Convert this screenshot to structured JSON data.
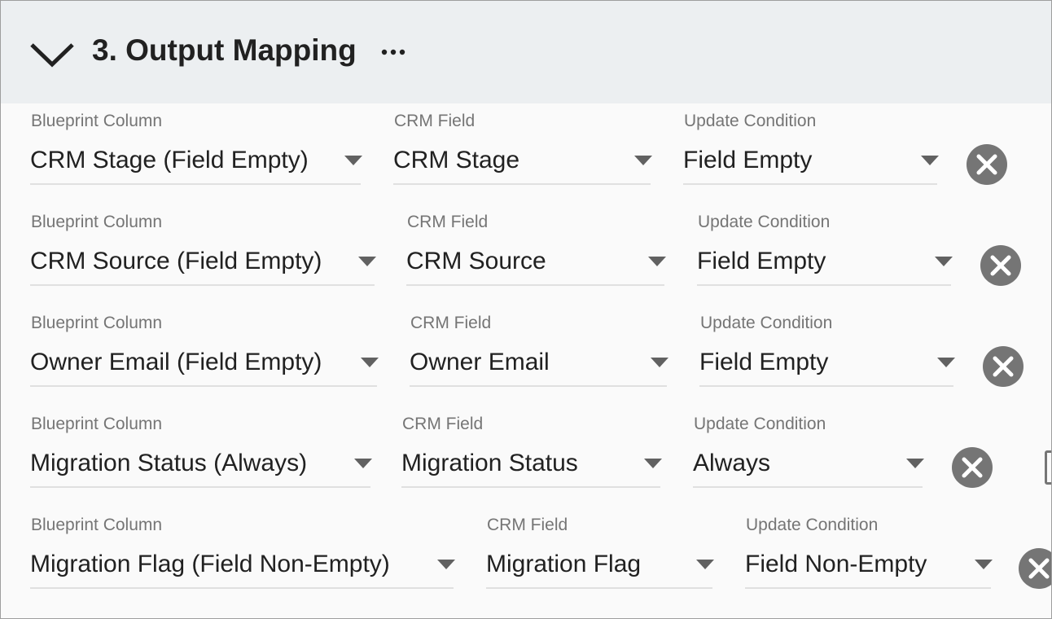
{
  "section": {
    "title": "3. Output Mapping",
    "more_label": "···"
  },
  "mappings": [
    {
      "blueprint_label": "Blueprint Column",
      "blueprint_value": "CRM Stage (Field Empty)",
      "crm_label": "CRM Field",
      "crm_value": "CRM Stage",
      "cond_label": "Update Condition",
      "cond_value": "Field Empty"
    },
    {
      "blueprint_label": "Blueprint Column",
      "blueprint_value": "CRM Source (Field Empty)",
      "crm_label": "CRM Field",
      "crm_value": "CRM Source",
      "cond_label": "Update Condition",
      "cond_value": "Field Empty"
    },
    {
      "blueprint_label": "Blueprint Column",
      "blueprint_value": "Owner Email (Field Empty)",
      "crm_label": "CRM Field",
      "crm_value": "Owner Email",
      "cond_label": "Update Condition",
      "cond_value": "Field Empty"
    },
    {
      "blueprint_label": "Blueprint Column",
      "blueprint_value": "Migration Status (Always)",
      "crm_label": "CRM Field",
      "crm_value": "Migration Status",
      "cond_label": "Update Condition",
      "cond_value": "Always"
    },
    {
      "blueprint_label": "Blueprint Column",
      "blueprint_value": "Migration Flag (Field Non-Empty)",
      "crm_label": "CRM Field",
      "crm_value": "Migration Flag",
      "cond_label": "Update Condition",
      "cond_value": "Field Non-Empty"
    }
  ],
  "icons": {
    "collapse": "chevron-down-icon",
    "more": "more-horizontal-icon",
    "dropdown": "arrow-drop-down-icon",
    "remove": "close-circle-icon"
  },
  "colors": {
    "header_bg": "#eceff1",
    "body_bg": "#fafafa",
    "text": "#212121",
    "label": "#757575",
    "remove_bg": "#757575",
    "underline": "#e0e0e0"
  }
}
